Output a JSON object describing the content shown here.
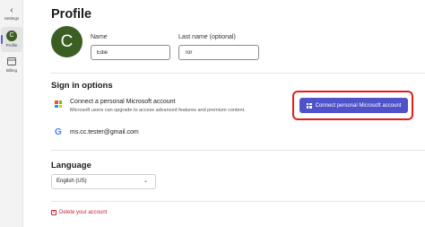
{
  "rail": {
    "back_icon": "chevron-left-icon",
    "settings_label": "Settings",
    "profile_initial": "C",
    "profile_label": "Profile",
    "billing_label": "Billing"
  },
  "profile": {
    "title": "Profile",
    "avatar_initial": "C",
    "avatar_color": "#3b5e23",
    "name_label": "Name",
    "name_value": "Edie",
    "last_name_label": "Last name (optional)",
    "last_name_value": "Tor"
  },
  "sign_in": {
    "title": "Sign in options",
    "microsoft": {
      "title": "Connect a personal Microsoft account",
      "description": "Microsoft users can upgrade to access advanced features and premium content.",
      "button_label": "Connect personal Microsoft account"
    },
    "google": {
      "icon": "google-icon",
      "email": "ms.cc.tester@gmail.com"
    }
  },
  "language": {
    "title": "Language",
    "selected": "English (US)"
  },
  "delete_label": "Delete your account",
  "colors": {
    "accent": "#4f52c9",
    "highlight": "#e0201b",
    "danger": "#c4262e"
  }
}
